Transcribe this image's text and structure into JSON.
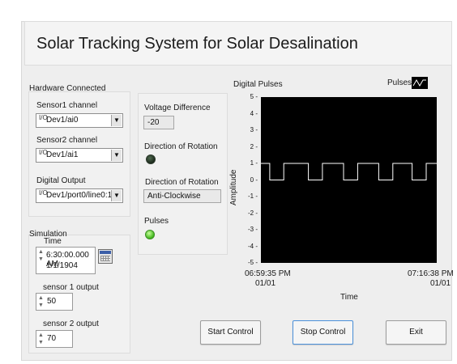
{
  "title": "Solar Tracking System for Solar Desalination",
  "hardware": {
    "heading": "Hardware Connected",
    "sensor1_label": "Sensor1 channel",
    "sensor1_value": "Dev1/ai0",
    "sensor2_label": "Sensor2 channel",
    "sensor2_value": "Dev1/ai1",
    "digital_label": "Digital Output",
    "digital_value": "Dev1/port0/line0:1",
    "io_glyph": "I/O",
    "dropdown_glyph": "▼"
  },
  "simulation": {
    "heading": "Simulation",
    "time_label": "Time",
    "time_value_line1": "6:30:00.000 AM",
    "time_value_line2": "1/1/1904",
    "sensor1_output_label": "sensor 1 output",
    "sensor1_output_value": "50",
    "sensor2_output_label": "sensor 2 output",
    "sensor2_output_value": "70"
  },
  "status": {
    "voltage_label": "Voltage Difference",
    "voltage_value": "-20",
    "direction_led_label": "Direction of Rotation",
    "direction_led_state": "off",
    "direction_text_label": "Direction of Rotation",
    "direction_text_value": "Anti-Clockwise",
    "pulses_label": "Pulses",
    "pulses_led_state": "on"
  },
  "buttons": {
    "start": "Start Control",
    "stop": "Stop Control",
    "exit": "Exit"
  },
  "chart_data": {
    "type": "line",
    "title": "Digital Pulses",
    "xlabel": "Time",
    "ylabel": "Amplitude",
    "ylim": [
      -5,
      5
    ],
    "yticks": [
      "5",
      "4",
      "3",
      "2",
      "1",
      "0",
      "-1",
      "-2",
      "-3",
      "-4",
      "-5"
    ],
    "x_start_line1": "06:59:35 PM",
    "x_start_line2": "01/01",
    "x_end_line1": "07:16:38 PM",
    "x_end_line2": "01/01",
    "series": [
      {
        "name": "Pulses",
        "color": "#ffffff",
        "x": [
          0,
          0.05,
          0.05,
          0.13,
          0.13,
          0.27,
          0.27,
          0.35,
          0.35,
          0.47,
          0.47,
          0.55,
          0.55,
          0.67,
          0.67,
          0.75,
          0.75,
          0.86,
          0.86,
          0.94,
          0.94,
          1.0
        ],
        "values": [
          1,
          1,
          0,
          0,
          1,
          1,
          0,
          0,
          1,
          1,
          0,
          0,
          1,
          1,
          0,
          0,
          1,
          1,
          0,
          0,
          1,
          1
        ]
      }
    ],
    "background": "#000000",
    "grid": false,
    "legend_position": "top-right"
  }
}
